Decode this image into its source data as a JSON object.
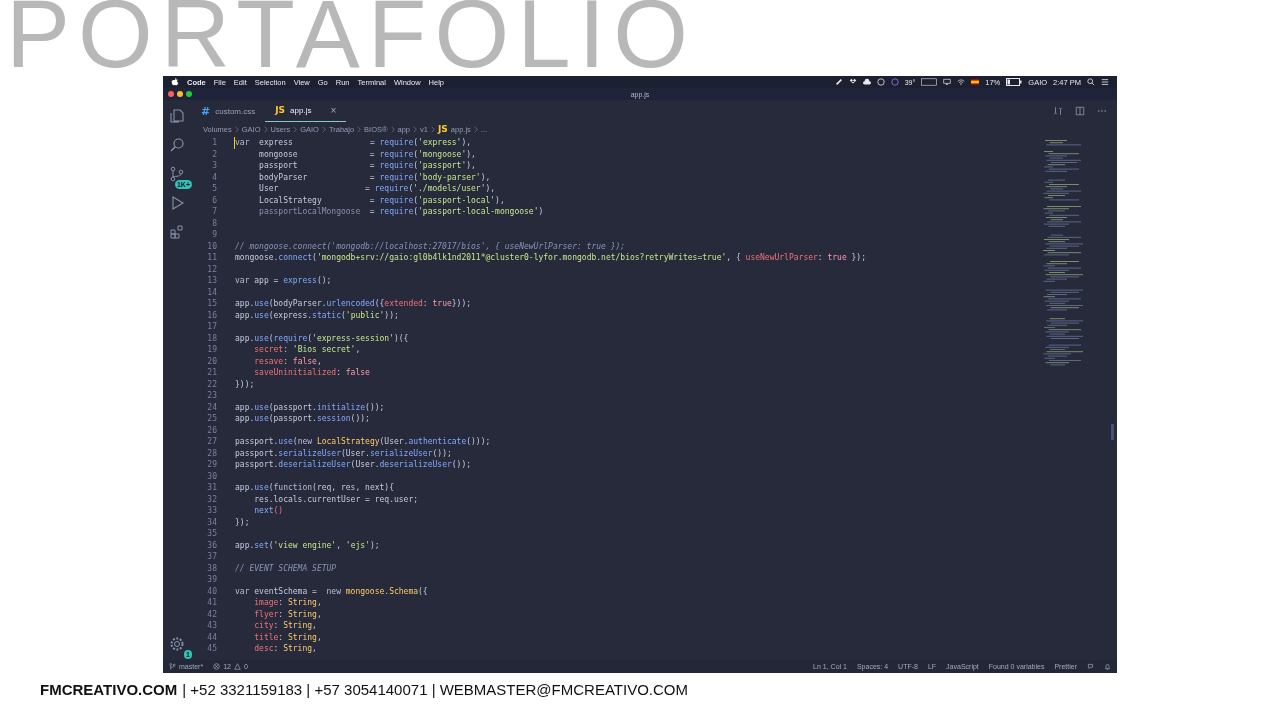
{
  "slide_title": "PORTAFOLIO",
  "menu_bar": {
    "items": [
      {
        "label": "Code",
        "bold": true
      },
      {
        "label": "File",
        "bold": false
      },
      {
        "label": "Edit",
        "bold": false
      },
      {
        "label": "Selection",
        "bold": false
      },
      {
        "label": "View",
        "bold": false
      },
      {
        "label": "Go",
        "bold": false
      },
      {
        "label": "Run",
        "bold": false
      },
      {
        "label": "Terminal",
        "bold": false
      },
      {
        "label": "Window",
        "bold": false
      },
      {
        "label": "Help",
        "bold": false
      }
    ],
    "temperature": "39°",
    "battery": "17%",
    "user": "GAIO",
    "clock": "2:47 PM"
  },
  "window": {
    "title": "app.js"
  },
  "activity_bar": {
    "source_control_badge": "1K+",
    "settings_badge": "1"
  },
  "tabs": [
    {
      "icon_text": "#",
      "color": "#42a5f5",
      "label": "custom.css",
      "selected": false
    },
    {
      "icon_text": "JS",
      "color": "#ffca28",
      "label": "app.js",
      "selected": true,
      "close": "×"
    }
  ],
  "breadcrumbs": [
    {
      "label": "Volumes"
    },
    {
      "label": "GAIO"
    },
    {
      "label": "Users"
    },
    {
      "label": "GAIO"
    },
    {
      "label": "Trabajo"
    },
    {
      "label": "BIOS®"
    },
    {
      "label": "app"
    },
    {
      "label": "v1"
    },
    {
      "label": "app.js",
      "icon_text": "JS"
    },
    {
      "label": "..."
    }
  ],
  "code_lines": [
    {
      "number": "1",
      "tokens": [
        {
          "kind": "kw",
          "text": "var"
        },
        {
          "kind": "plain",
          "text": "  express                "
        },
        {
          "kind": "plain",
          "text": "= "
        },
        {
          "kind": "fn",
          "text": "require"
        },
        {
          "kind": "plain",
          "text": "("
        },
        {
          "kind": "str",
          "text": "'express'"
        },
        {
          "kind": "plain",
          "text": "),"
        }
      ]
    },
    {
      "number": "2",
      "tokens": [
        {
          "kind": "plain",
          "text": "     mongoose               = "
        },
        {
          "kind": "fn",
          "text": "require"
        },
        {
          "kind": "plain",
          "text": "("
        },
        {
          "kind": "str",
          "text": "'mongoose'"
        },
        {
          "kind": "plain",
          "text": "),"
        }
      ]
    },
    {
      "number": "3",
      "tokens": [
        {
          "kind": "plain",
          "text": "     passport               = "
        },
        {
          "kind": "fn",
          "text": "require"
        },
        {
          "kind": "plain",
          "text": "("
        },
        {
          "kind": "str",
          "text": "'passport'"
        },
        {
          "kind": "plain",
          "text": "),"
        }
      ]
    },
    {
      "number": "4",
      "tokens": [
        {
          "kind": "plain",
          "text": "     bodyParser             = "
        },
        {
          "kind": "fn",
          "text": "require"
        },
        {
          "kind": "plain",
          "text": "("
        },
        {
          "kind": "str",
          "text": "'body-parser'"
        },
        {
          "kind": "plain",
          "text": "),"
        }
      ]
    },
    {
      "number": "5",
      "tokens": [
        {
          "kind": "plain",
          "text": "     User                  = "
        },
        {
          "kind": "fn",
          "text": "require"
        },
        {
          "kind": "plain",
          "text": "("
        },
        {
          "kind": "str",
          "text": "'./models/user'"
        },
        {
          "kind": "plain",
          "text": "),"
        }
      ]
    },
    {
      "number": "6",
      "tokens": [
        {
          "kind": "plain",
          "text": "     LocalStrategy          = "
        },
        {
          "kind": "fn",
          "text": "require"
        },
        {
          "kind": "plain",
          "text": "("
        },
        {
          "kind": "str",
          "text": "'passport-local'"
        },
        {
          "kind": "plain",
          "text": "),"
        }
      ]
    },
    {
      "number": "7",
      "tokens": [
        {
          "kind": "dim",
          "text": "     passportLocalMongoose  "
        },
        {
          "kind": "plain",
          "text": "= "
        },
        {
          "kind": "fn",
          "text": "require"
        },
        {
          "kind": "plain",
          "text": "("
        },
        {
          "kind": "str",
          "text": "'passport-local-mongoose'"
        },
        {
          "kind": "plain",
          "text": ")"
        }
      ]
    },
    {
      "number": "8"
    },
    {
      "number": "9"
    },
    {
      "number": "10",
      "tokens": [
        {
          "kind": "comment",
          "text": "// mongoose.connect('mongodb://localhost:27017/bios', { useNewUrlParser: true });"
        }
      ]
    },
    {
      "number": "11",
      "tokens": [
        {
          "kind": "plain",
          "text": "mongoose."
        },
        {
          "kind": "fn",
          "text": "connect"
        },
        {
          "kind": "plain",
          "text": "("
        },
        {
          "kind": "str",
          "text": "'mongodb+srv://gaio:gl0b4lk1nd2011*@cluster0-lyfor.mongodb.net/bios?retryWrites=true'"
        },
        {
          "kind": "plain",
          "text": ", { "
        },
        {
          "kind": "prop",
          "text": "useNewUrlParser"
        },
        {
          "kind": "plain",
          "text": ": "
        },
        {
          "kind": "bool",
          "text": "true"
        },
        {
          "kind": "plain",
          "text": " });"
        }
      ]
    },
    {
      "number": "12"
    },
    {
      "number": "13",
      "tokens": [
        {
          "kind": "kw",
          "text": "var"
        },
        {
          "kind": "plain",
          "text": " app = "
        },
        {
          "kind": "fn",
          "text": "express"
        },
        {
          "kind": "plain",
          "text": "();"
        }
      ]
    },
    {
      "number": "14"
    },
    {
      "number": "15",
      "tokens": [
        {
          "kind": "plain",
          "text": "app."
        },
        {
          "kind": "fn",
          "text": "use"
        },
        {
          "kind": "plain",
          "text": "(bodyParser."
        },
        {
          "kind": "fn",
          "text": "urlencoded"
        },
        {
          "kind": "plain",
          "text": "({"
        },
        {
          "kind": "prop",
          "text": "extended"
        },
        {
          "kind": "plain",
          "text": ": "
        },
        {
          "kind": "bool",
          "text": "true"
        },
        {
          "kind": "plain",
          "text": "}));"
        }
      ]
    },
    {
      "number": "16",
      "tokens": [
        {
          "kind": "plain",
          "text": "app."
        },
        {
          "kind": "fn",
          "text": "use"
        },
        {
          "kind": "plain",
          "text": "(express."
        },
        {
          "kind": "fn",
          "text": "static"
        },
        {
          "kind": "plain",
          "text": "("
        },
        {
          "kind": "str",
          "text": "'public'"
        },
        {
          "kind": "plain",
          "text": "));"
        }
      ]
    },
    {
      "number": "17"
    },
    {
      "number": "18",
      "tokens": [
        {
          "kind": "plain",
          "text": "app."
        },
        {
          "kind": "fn",
          "text": "use"
        },
        {
          "kind": "plain",
          "text": "("
        },
        {
          "kind": "fn",
          "text": "require"
        },
        {
          "kind": "plain",
          "text": "("
        },
        {
          "kind": "str",
          "text": "'express-session'"
        },
        {
          "kind": "plain",
          "text": ")({"
        }
      ]
    },
    {
      "number": "19",
      "indented": true,
      "tokens": [
        {
          "kind": "prop",
          "text": "secret"
        },
        {
          "kind": "plain",
          "text": ": "
        },
        {
          "kind": "str",
          "text": "'Bios secret'"
        },
        {
          "kind": "plain",
          "text": ","
        }
      ]
    },
    {
      "number": "20",
      "indented": true,
      "tokens": [
        {
          "kind": "prop",
          "text": "resave"
        },
        {
          "kind": "plain",
          "text": ": "
        },
        {
          "kind": "bool",
          "text": "false"
        },
        {
          "kind": "plain",
          "text": ","
        }
      ]
    },
    {
      "number": "21",
      "indented": true,
      "tokens": [
        {
          "kind": "prop",
          "text": "saveUninitialized"
        },
        {
          "kind": "plain",
          "text": ": "
        },
        {
          "kind": "bool",
          "text": "false"
        }
      ]
    },
    {
      "number": "22",
      "tokens": [
        {
          "kind": "plain",
          "text": "}));"
        }
      ]
    },
    {
      "number": "23"
    },
    {
      "number": "24",
      "tokens": [
        {
          "kind": "plain",
          "text": "app."
        },
        {
          "kind": "fn",
          "text": "use"
        },
        {
          "kind": "plain",
          "text": "(passport."
        },
        {
          "kind": "fn",
          "text": "initialize"
        },
        {
          "kind": "plain",
          "text": "());"
        }
      ]
    },
    {
      "number": "25",
      "tokens": [
        {
          "kind": "plain",
          "text": "app."
        },
        {
          "kind": "fn",
          "text": "use"
        },
        {
          "kind": "plain",
          "text": "(passport."
        },
        {
          "kind": "fn",
          "text": "session"
        },
        {
          "kind": "plain",
          "text": "());"
        }
      ]
    },
    {
      "number": "26"
    },
    {
      "number": "27",
      "tokens": [
        {
          "kind": "plain",
          "text": "passport."
        },
        {
          "kind": "fn",
          "text": "use"
        },
        {
          "kind": "plain",
          "text": "("
        },
        {
          "kind": "kw",
          "text": "new"
        },
        {
          "kind": "cls",
          "text": "LocalStrategy",
          "space_before": true
        },
        {
          "kind": "plain",
          "text": "(User."
        },
        {
          "kind": "fn",
          "text": "authenticate"
        },
        {
          "kind": "plain",
          "text": "()));"
        }
      ]
    },
    {
      "number": "28",
      "tokens": [
        {
          "kind": "plain",
          "text": "passport."
        },
        {
          "kind": "fn",
          "text": "serializeUser"
        },
        {
          "kind": "plain",
          "text": "(User."
        },
        {
          "kind": "fn",
          "text": "serializeUser"
        },
        {
          "kind": "plain",
          "text": "());"
        }
      ]
    },
    {
      "number": "29",
      "tokens": [
        {
          "kind": "plain",
          "text": "passport."
        },
        {
          "kind": "fn",
          "text": "deserializeUser"
        },
        {
          "kind": "plain",
          "text": "(User."
        },
        {
          "kind": "fn",
          "text": "deserializeUser"
        },
        {
          "kind": "plain",
          "text": "());"
        }
      ]
    },
    {
      "number": "30"
    },
    {
      "number": "31",
      "tokens": [
        {
          "kind": "plain",
          "text": "app."
        },
        {
          "kind": "fn",
          "text": "use"
        },
        {
          "kind": "plain",
          "text": "("
        },
        {
          "kind": "kw",
          "text": "function"
        },
        {
          "kind": "plain",
          "text": "(req, res, next){"
        }
      ]
    },
    {
      "number": "32",
      "indented": true,
      "tokens": [
        {
          "kind": "plain",
          "text": "res.locals.currentUser = req.user;"
        }
      ]
    },
    {
      "number": "33",
      "indented": true,
      "tokens": [
        {
          "kind": "fn",
          "text": "next"
        },
        {
          "kind": "prop",
          "text": "()"
        }
      ]
    },
    {
      "number": "34",
      "tokens": [
        {
          "kind": "plain",
          "text": "});"
        }
      ]
    },
    {
      "number": "35"
    },
    {
      "number": "36",
      "tokens": [
        {
          "kind": "plain",
          "text": "app."
        },
        {
          "kind": "fn",
          "text": "set"
        },
        {
          "kind": "plain",
          "text": "("
        },
        {
          "kind": "str",
          "text": "'view engine'"
        },
        {
          "kind": "plain",
          "text": ", "
        },
        {
          "kind": "str",
          "text": "'ejs'"
        },
        {
          "kind": "plain",
          "text": ");"
        }
      ]
    },
    {
      "number": "37"
    },
    {
      "number": "38",
      "tokens": [
        {
          "kind": "comment",
          "text": "// EVENT SCHEMA SETUP"
        }
      ]
    },
    {
      "number": "39"
    },
    {
      "number": "40",
      "tokens": [
        {
          "kind": "kw",
          "text": "var"
        },
        {
          "kind": "plain",
          "text": " eventSchema =  "
        },
        {
          "kind": "kw",
          "text": "new"
        },
        {
          "kind": "cls",
          "text": "mongoose",
          "space_before": true
        },
        {
          "kind": "plain",
          "text": "."
        },
        {
          "kind": "cls",
          "text": "Schema"
        },
        {
          "kind": "plain",
          "text": "({"
        }
      ]
    },
    {
      "number": "41",
      "indented": true,
      "tokens": [
        {
          "kind": "prop",
          "text": "image"
        },
        {
          "kind": "plain",
          "text": ": "
        },
        {
          "kind": "cls",
          "text": "String"
        },
        {
          "kind": "plain",
          "text": ","
        }
      ]
    },
    {
      "number": "42",
      "indented": true,
      "tokens": [
        {
          "kind": "prop",
          "text": "flyer"
        },
        {
          "kind": "plain",
          "text": ": "
        },
        {
          "kind": "cls",
          "text": "String"
        },
        {
          "kind": "plain",
          "text": ","
        }
      ]
    },
    {
      "number": "43",
      "indented": true,
      "tokens": [
        {
          "kind": "prop",
          "text": "city"
        },
        {
          "kind": "plain",
          "text": ": "
        },
        {
          "kind": "cls",
          "text": "String"
        },
        {
          "kind": "plain",
          "text": ","
        }
      ]
    },
    {
      "number": "44",
      "indented": true,
      "tokens": [
        {
          "kind": "prop",
          "text": "title"
        },
        {
          "kind": "plain",
          "text": ": "
        },
        {
          "kind": "cls",
          "text": "String"
        },
        {
          "kind": "plain",
          "text": ","
        }
      ]
    },
    {
      "number": "45",
      "indented": true,
      "tokens": [
        {
          "kind": "prop",
          "text": "desc"
        },
        {
          "kind": "plain",
          "text": ": "
        },
        {
          "kind": "cls",
          "text": "String"
        },
        {
          "kind": "plain",
          "text": ","
        }
      ]
    }
  ],
  "status_bar": {
    "branch": "master*",
    "errors": "12",
    "warnings": "0",
    "right_items": [
      {
        "label": "Ln 1, Col 1"
      },
      {
        "label": "Spaces: 4"
      },
      {
        "label": "UTF-8"
      },
      {
        "label": "LF"
      },
      {
        "label": "JavaScript"
      },
      {
        "label": "Found 0 variables"
      },
      {
        "label": "Prettier"
      }
    ]
  },
  "footer": {
    "brand": "FMCREATIVO.COM",
    "contact": "| +52 3321159183 | +57 3054140071 | WEBMASTER@FMCREATIVO.COM"
  }
}
